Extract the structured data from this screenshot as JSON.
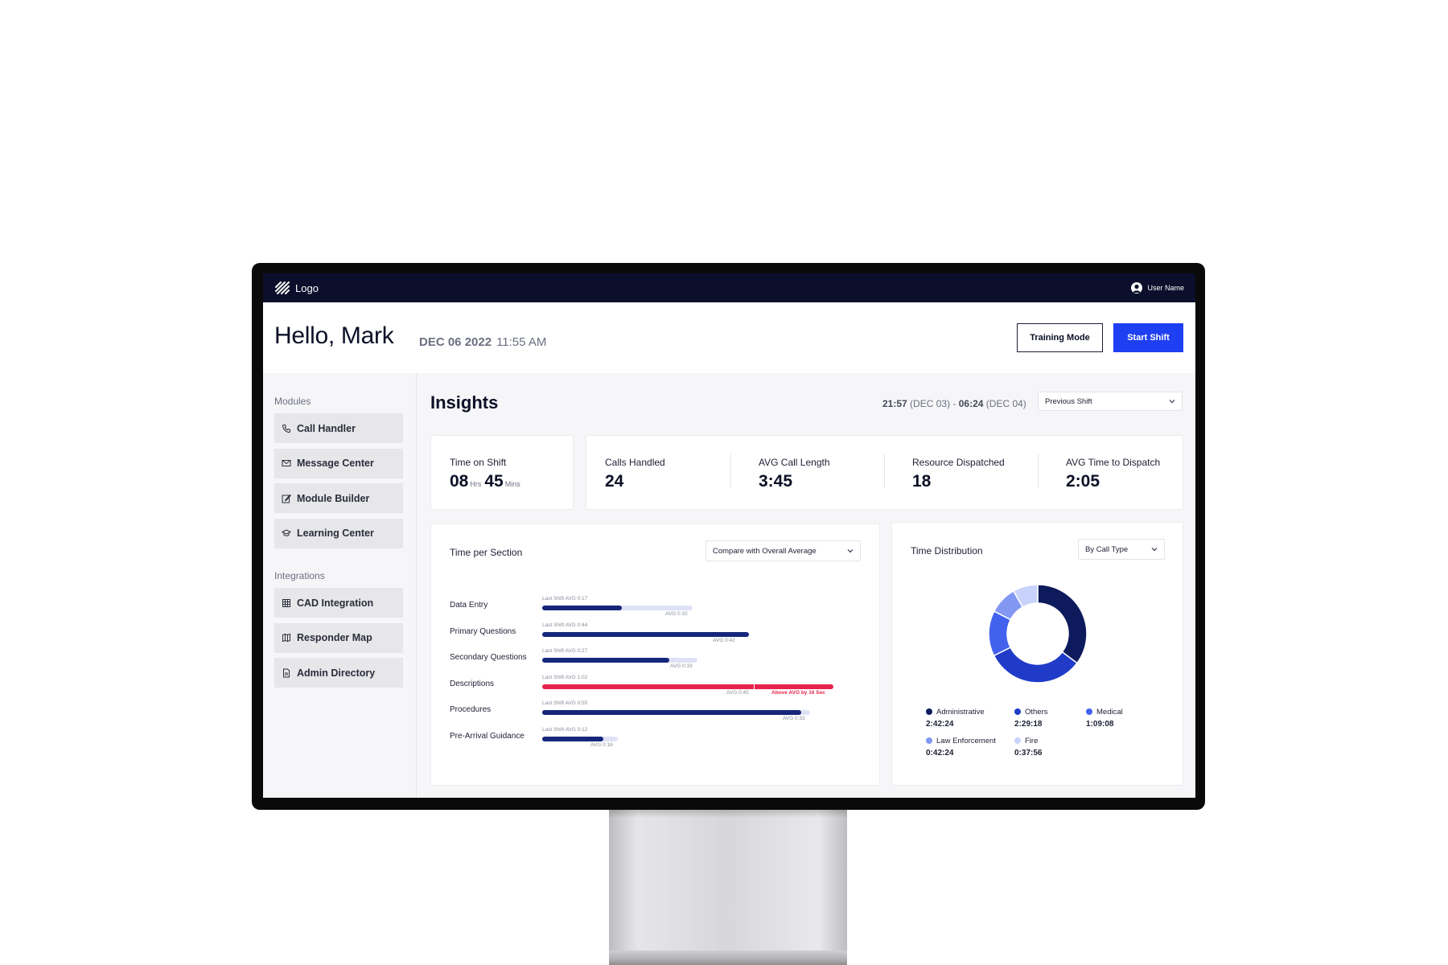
{
  "app": {
    "logo_text": "Logo",
    "user_name": "User Name"
  },
  "header": {
    "greeting": "Hello, Mark",
    "date": "DEC 06 2022",
    "time": "11:55 AM",
    "training_button": "Training Mode",
    "start_button": "Start Shift"
  },
  "sidebar": {
    "modules_title": "Modules",
    "modules": [
      {
        "label": "Call Handler",
        "icon": "phone-icon"
      },
      {
        "label": "Message Center",
        "icon": "mail-icon"
      },
      {
        "label": "Module Builder",
        "icon": "edit-icon"
      },
      {
        "label": "Learning Center",
        "icon": "graduation-cap-icon"
      }
    ],
    "integrations_title": "Integrations",
    "integrations": [
      {
        "label": "CAD Integration",
        "icon": "grid-icon"
      },
      {
        "label": "Responder Map",
        "icon": "map-icon"
      },
      {
        "label": "Admin Directory",
        "icon": "document-icon"
      }
    ]
  },
  "insights": {
    "title": "Insights",
    "range_start_time": "21:57",
    "range_start_date": "(DEC 03)",
    "range_sep": "-",
    "range_end_time": "06:24",
    "range_end_date": "(DEC 04)",
    "shift_select": "Previous Shift"
  },
  "stats": {
    "time_on_shift_label": "Time on Shift",
    "hours": "08",
    "hours_unit": "Hrs",
    "mins": "45",
    "mins_unit": "Mins",
    "calls_handled_label": "Calls Handled",
    "calls_handled": "24",
    "avg_call_length_label": "AVG Call Length",
    "avg_call_length": "3:45",
    "resource_dispatched_label": "Resource Dispatched",
    "resource_dispatched": "18",
    "avg_time_to_dispatch_label": "AVG Time to Dispatch",
    "avg_time_to_dispatch": "2:05"
  },
  "time_per_section": {
    "title": "Time per Section",
    "compare_select": "Compare with Overall Average",
    "rows": [
      {
        "label": "Data Entry",
        "last_note": "Last Shift AVG 0:17",
        "avg_note": "AVG 0:32",
        "last_sec": 17,
        "avg_sec": 32,
        "above": false,
        "above_note": ""
      },
      {
        "label": "Primary Questions",
        "last_note": "Last Shift AVG 0:44",
        "avg_note": "AVG 0:42",
        "last_sec": 44,
        "avg_sec": 42,
        "above": false,
        "above_note": ""
      },
      {
        "label": "Secondary Questions",
        "last_note": "Last Shift AVG 0:27",
        "avg_note": "AVG 0:33",
        "last_sec": 27,
        "avg_sec": 33,
        "above": false,
        "above_note": ""
      },
      {
        "label": "Descriptions",
        "last_note": "Last Shift AVG 1:02",
        "avg_note": "AVG 0:45",
        "last_sec": 62,
        "avg_sec": 45,
        "above": true,
        "above_note": "Above AVG by 16 Sec"
      },
      {
        "label": "Procedures",
        "last_note": "Last Shift AVG 0:55",
        "avg_note": "AVG 0:33",
        "last_sec": 55,
        "avg_sec": 57,
        "above": false,
        "above_note": ""
      },
      {
        "label": "Pre-Arrival Guidance",
        "last_note": "Last Shift AVG 0:12",
        "avg_note": "AVG 0:16",
        "last_sec": 13,
        "avg_sec": 16,
        "above": false,
        "above_note": ""
      }
    ]
  },
  "time_distribution": {
    "title": "Time Distribution",
    "select": "By Call Type"
  },
  "chart_data": {
    "type": "pie",
    "variant": "donut",
    "slices": [
      {
        "name": "Administrative",
        "label": "2:42:24",
        "seconds": 9744,
        "color": "#0d1a5c"
      },
      {
        "name": "Others",
        "label": "2:29:18",
        "seconds": 8958,
        "color": "#1f3bc7"
      },
      {
        "name": "Medical",
        "label": "1:09:08",
        "seconds": 4148,
        "color": "#4262ee"
      },
      {
        "name": "Law Enforcement",
        "label": "0:42:24",
        "seconds": 2544,
        "color": "#8297f2"
      },
      {
        "name": "Fire",
        "label": "0:37:56",
        "seconds": 2276,
        "color": "#c9d2fa"
      }
    ]
  }
}
